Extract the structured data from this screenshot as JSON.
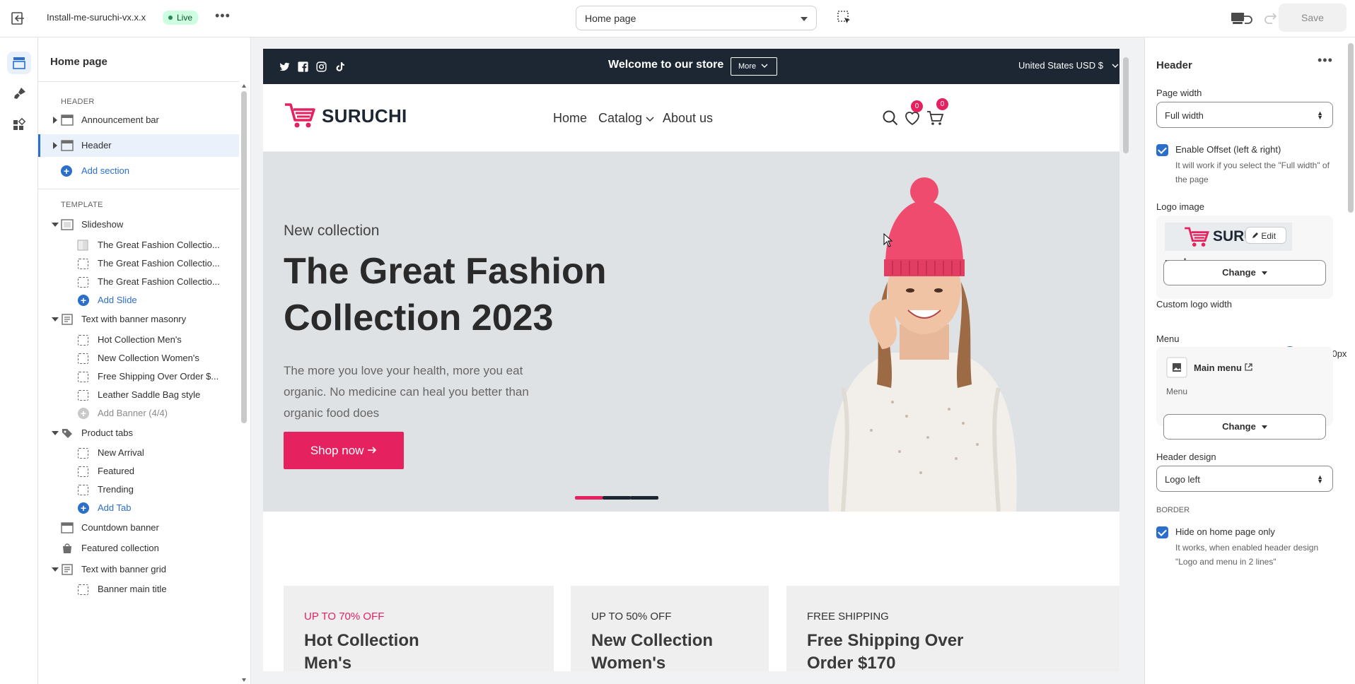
{
  "topbar": {
    "theme_name": "Install-me-suruchi-vx.x.x",
    "status_badge": "Live",
    "page_select": "Home page",
    "save_label": "Save"
  },
  "sidebar": {
    "title": "Home page",
    "header_group": "HEADER",
    "header_sections": [
      "Announcement bar",
      "Header"
    ],
    "add_section": "Add section",
    "template_group": "TEMPLATE",
    "slideshow": {
      "label": "Slideshow",
      "blocks": [
        "The Great Fashion Collectio...",
        "The Great Fashion Collectio...",
        "The Great Fashion Collectio..."
      ],
      "add": "Add Slide"
    },
    "masonry": {
      "label": "Text with banner masonry",
      "blocks": [
        "Hot Collection Men's",
        "New Collection Women's",
        "Free Shipping Over Order $...",
        "Leather Saddle Bag style"
      ],
      "add": "Add Banner (4/4)"
    },
    "product_tabs": {
      "label": "Product tabs",
      "blocks": [
        "New Arrival",
        "Featured",
        "Trending"
      ],
      "add": "Add Tab"
    },
    "countdown": "Countdown banner",
    "featured": "Featured collection",
    "banner_grid": {
      "label": "Text with banner grid",
      "blocks": [
        "Banner main title"
      ]
    }
  },
  "preview": {
    "announcement": {
      "text": "Welcome to our store",
      "more": "More",
      "currency": "United States USD $"
    },
    "header": {
      "logo": "SURUCHI",
      "nav": [
        "Home",
        "Catalog",
        "About us"
      ],
      "wishlist_count": "0",
      "cart_count": "0"
    },
    "hero": {
      "kicker": "New collection",
      "title": "The Great Fashion Collection 2023",
      "subtitle": "The more you love your health, more you eat organic. No medicine can heal you better than organic food does",
      "button": "Shop now",
      "active_slide": 1,
      "slide_count": 3
    },
    "banners": [
      {
        "kicker": "UP TO 70% OFF",
        "title": "Hot Collection Men's"
      },
      {
        "kicker": "UP TO 50% OFF",
        "title": "New Collection Women's"
      },
      {
        "kicker": "FREE SHIPPING",
        "title": "Free Shipping Over Order $170"
      }
    ]
  },
  "settings": {
    "title": "Header",
    "page_width_label": "Page width",
    "page_width_value": "Full width",
    "offset_label": "Enable Offset (left & right)",
    "offset_help": "It will work if you select the \"Full width\" of the page",
    "logo_label": "Logo image",
    "logo_preview_text": "SURU",
    "logo_edit": "Edit",
    "logo_file": "nav-log",
    "logo_type": "PNG",
    "change_label": "Change",
    "logo_width_label": "Custom logo width",
    "logo_width_value": "200px",
    "logo_width_fraction": 0.75,
    "menu_label": "Menu",
    "menu_name": "Main menu",
    "menu_type": "Menu",
    "header_design_label": "Header design",
    "header_design_value": "Logo left",
    "border_group": "BORDER",
    "hide_label": "Hide on home page only",
    "hide_help": "It works, when enabled header design \"Logo and menu in 2 lines\""
  },
  "colors": {
    "accent": "#e5215f",
    "dark": "#1d2633",
    "admin_blue": "#2c6ecb"
  }
}
